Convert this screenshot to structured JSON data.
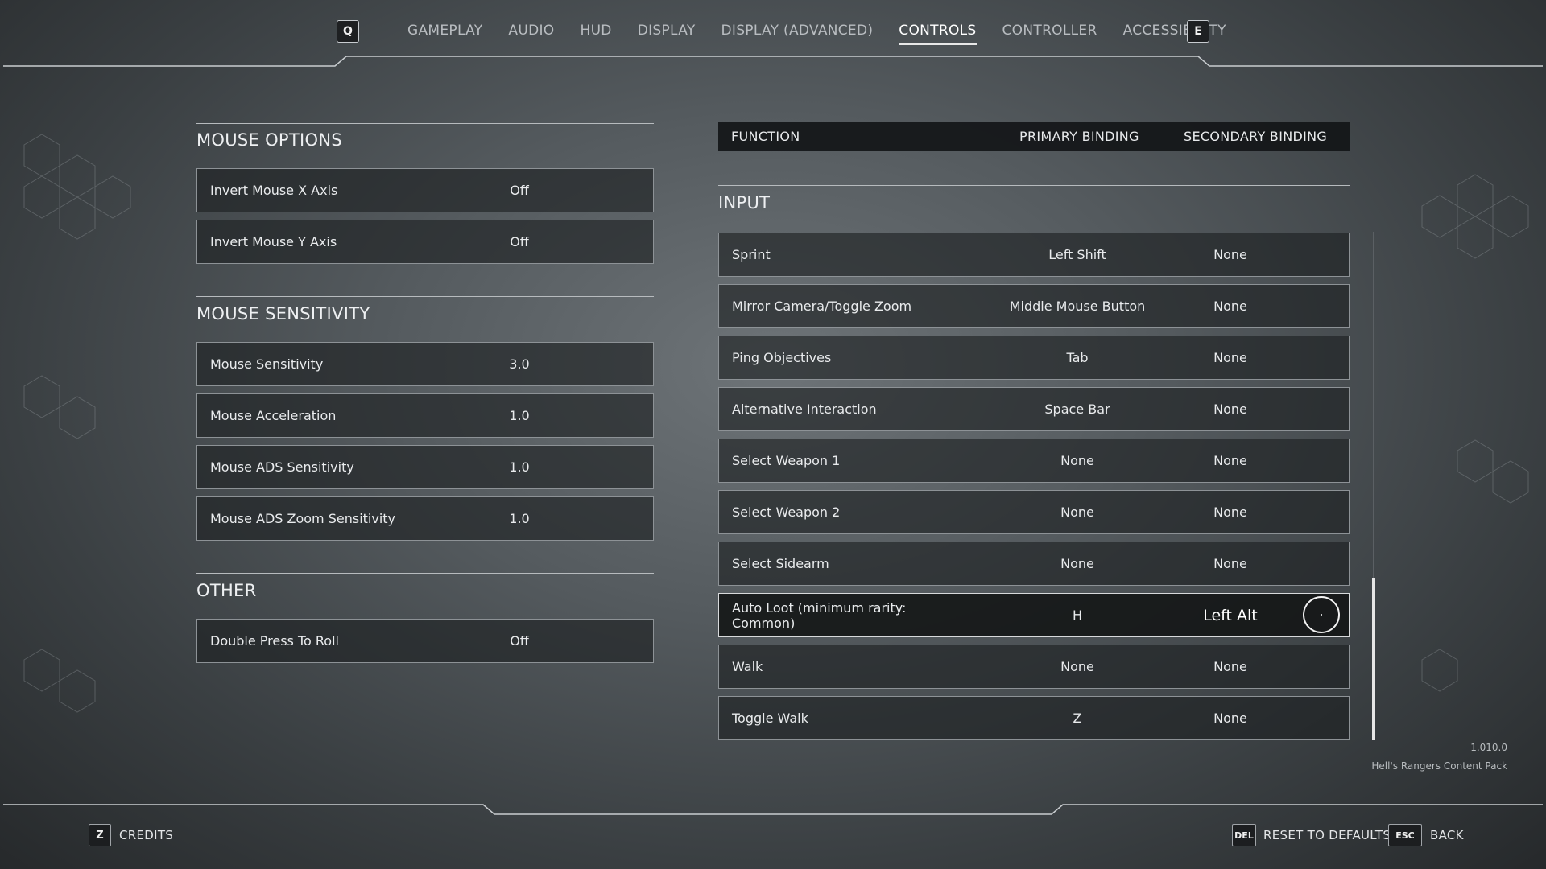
{
  "nav": {
    "prev_key": "Q",
    "next_key": "E",
    "tabs": [
      {
        "label": "GAMEPLAY",
        "active": false
      },
      {
        "label": "AUDIO",
        "active": false
      },
      {
        "label": "HUD",
        "active": false
      },
      {
        "label": "DISPLAY",
        "active": false
      },
      {
        "label": "DISPLAY (ADVANCED)",
        "active": false
      },
      {
        "label": "CONTROLS",
        "active": true
      },
      {
        "label": "CONTROLLER",
        "active": false
      },
      {
        "label": "ACCESSIBILITY",
        "active": false
      }
    ]
  },
  "left": {
    "mouse_options": {
      "title": "MOUSE OPTIONS",
      "rows": [
        {
          "label": "Invert Mouse X Axis",
          "value": "Off"
        },
        {
          "label": "Invert Mouse Y Axis",
          "value": "Off"
        }
      ]
    },
    "mouse_sensitivity": {
      "title": "MOUSE SENSITIVITY",
      "rows": [
        {
          "label": "Mouse Sensitivity",
          "value": "3.0"
        },
        {
          "label": "Mouse Acceleration",
          "value": "1.0"
        },
        {
          "label": "Mouse ADS Sensitivity",
          "value": "1.0"
        },
        {
          "label": "Mouse ADS Zoom Sensitivity",
          "value": "1.0"
        }
      ]
    },
    "other": {
      "title": "OTHER",
      "rows": [
        {
          "label": "Double Press To Roll",
          "value": "Off"
        }
      ]
    }
  },
  "bindings": {
    "header": {
      "function": "FUNCTION",
      "primary": "PRIMARY BINDING",
      "secondary": "SECONDARY BINDING"
    },
    "section_title": "INPUT",
    "rows": [
      {
        "function": "Sprint",
        "primary": "Left Shift",
        "secondary": "None"
      },
      {
        "function": "Mirror Camera/Toggle Zoom",
        "primary": "Middle Mouse Button",
        "secondary": "None"
      },
      {
        "function": "Ping Objectives",
        "primary": "Tab",
        "secondary": "None"
      },
      {
        "function": "Alternative Interaction",
        "primary": "Space Bar",
        "secondary": "None"
      },
      {
        "function": "Select Weapon 1",
        "primary": "None",
        "secondary": "None"
      },
      {
        "function": "Select Weapon 2",
        "primary": "None",
        "secondary": "None"
      },
      {
        "function": "Select Sidearm",
        "primary": "None",
        "secondary": "None"
      },
      {
        "function": "Auto Loot (minimum rarity: Common)",
        "primary": "H",
        "secondary": "Left Alt"
      },
      {
        "function": "Walk",
        "primary": "None",
        "secondary": "None"
      },
      {
        "function": "Toggle Walk",
        "primary": "Z",
        "secondary": "None"
      }
    ]
  },
  "info": {
    "version": "1.010.0",
    "pack": "Hell's Rangers Content Pack"
  },
  "footer": {
    "credits_key": "Z",
    "credits_label": "CREDITS",
    "reset_key": "DEL",
    "reset_label": "RESET TO DEFAULTS",
    "back_key": "ESC",
    "back_label": "BACK"
  },
  "colors": {
    "background": "#555b5f",
    "row_border": "#8d9296",
    "accent": "#ffffff"
  }
}
